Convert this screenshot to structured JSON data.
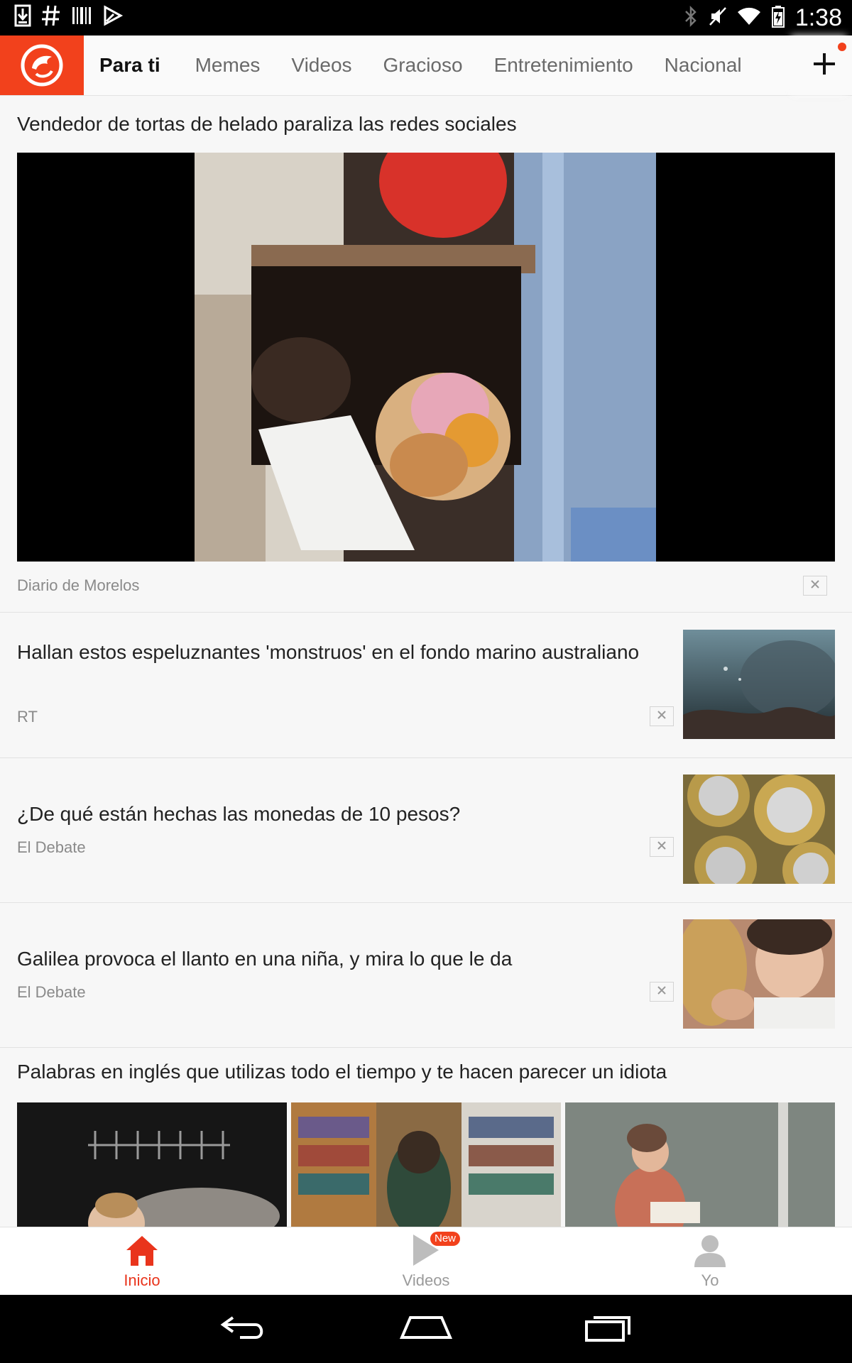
{
  "status_bar": {
    "time": "1:38",
    "left_icons": [
      "download-icon",
      "hashtag-icon",
      "barcode-icon",
      "play-store-icon"
    ],
    "right_icons": [
      "bluetooth-icon",
      "mute-icon",
      "wifi-icon",
      "battery-icon"
    ]
  },
  "top_bar": {
    "logo": "app-logo",
    "tabs": [
      "Para ti",
      "Memes",
      "Videos",
      "Gracioso",
      "Entretenimiento",
      "Nacional"
    ],
    "active_tab": "Para ti",
    "add_icon": "plus-icon"
  },
  "feed": {
    "featured": {
      "title": "Vendedor de tortas de helado paraliza las redes sociales",
      "source": "Diario de Morelos"
    },
    "items": [
      {
        "title": "Hallan estos espeluznantes 'monstruos' en el fondo marino australiano",
        "source": "RT"
      },
      {
        "title": "¿De qué están hechas las monedas de 10 pesos?",
        "source": "El Debate"
      },
      {
        "title": "Galilea provoca el llanto en una niña, y mira lo que le da",
        "source": "El Debate"
      }
    ],
    "multi": {
      "title": "Palabras en inglés que utilizas todo el tiempo y te hacen parecer un idiota"
    }
  },
  "bottom_nav": {
    "items": [
      {
        "label": "Inicio",
        "icon": "home-icon",
        "active": true
      },
      {
        "label": "Videos",
        "icon": "play-icon",
        "badge": "New"
      },
      {
        "label": "Yo",
        "icon": "person-icon"
      }
    ]
  },
  "system_nav": [
    "back-icon",
    "home-nav-icon",
    "recents-icon"
  ],
  "colors": {
    "accent": "#f2411c",
    "active_nav": "#e9341c"
  }
}
